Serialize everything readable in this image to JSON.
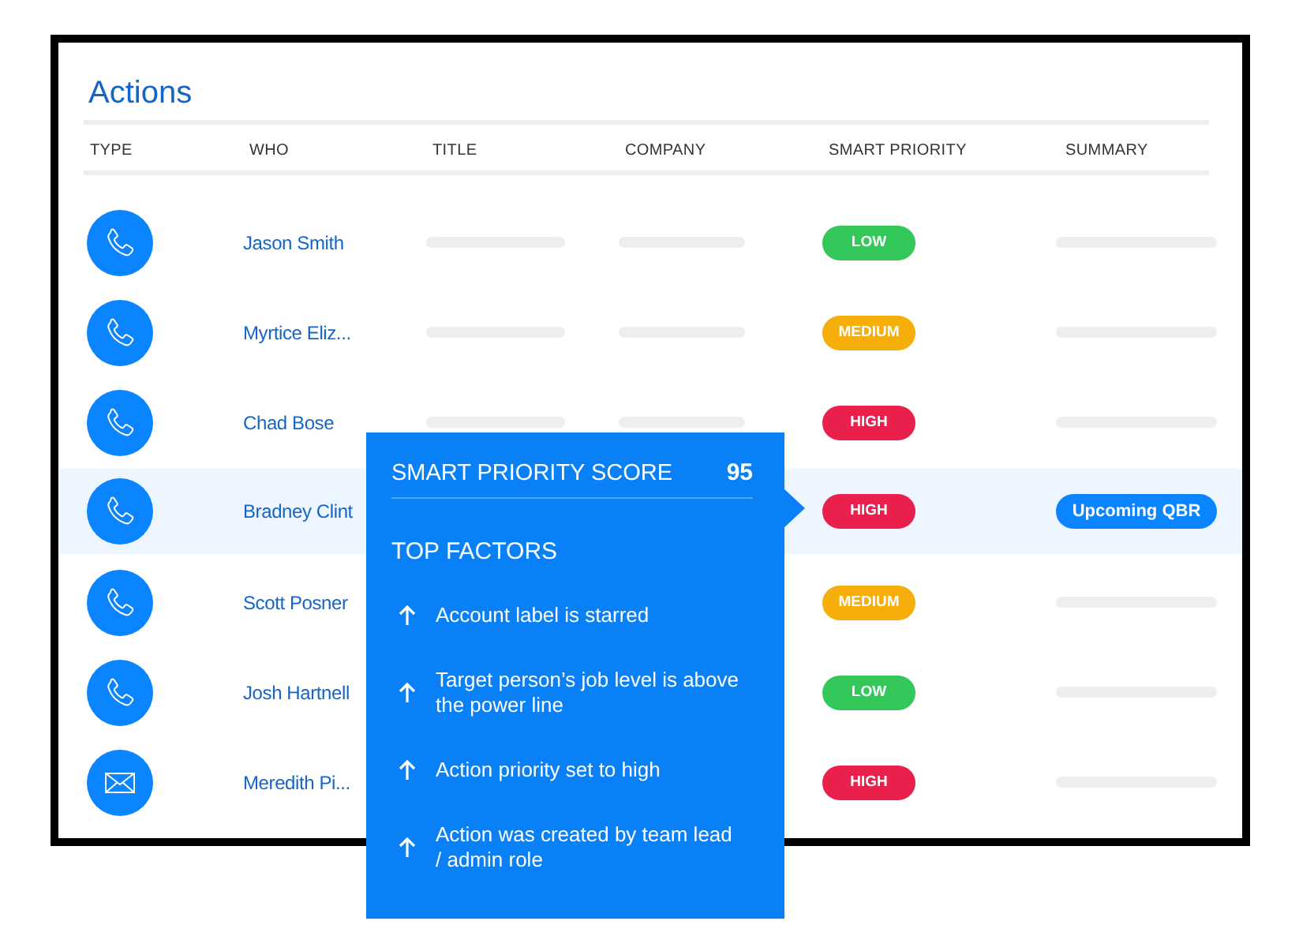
{
  "panel": {
    "title": "Actions"
  },
  "table": {
    "columns": [
      "TYPE",
      "WHO",
      "TITLE",
      "COMPANY",
      "SMART PRIORITY",
      "SUMMARY"
    ],
    "rows": [
      {
        "kind": "call",
        "who": "Jason Smith",
        "title_bar": true,
        "company_bar": true,
        "priority": {
          "label": "LOW",
          "color": "#34c759"
        },
        "summary": {
          "kind": "bar"
        },
        "selected": false
      },
      {
        "kind": "call",
        "who": "Myrtice Eliz...",
        "title_bar": true,
        "company_bar": true,
        "priority": {
          "label": "MEDIUM",
          "color": "#f6ae0a"
        },
        "summary": {
          "kind": "bar"
        },
        "selected": false
      },
      {
        "kind": "call",
        "who": "Chad Bose",
        "title_bar": true,
        "company_bar": true,
        "priority": {
          "label": "HIGH",
          "color": "#e8204b"
        },
        "summary": {
          "kind": "bar"
        },
        "selected": false
      },
      {
        "kind": "call",
        "who": "Bradney Clint",
        "title_bar": false,
        "company_bar": false,
        "priority": {
          "label": "HIGH",
          "color": "#e8204b"
        },
        "summary": {
          "kind": "tag",
          "text": "Upcoming QBR"
        },
        "selected": true
      },
      {
        "kind": "call",
        "who": "Scott Posner",
        "title_bar": false,
        "company_bar": false,
        "priority": {
          "label": "MEDIUM",
          "color": "#f6ae0a"
        },
        "summary": {
          "kind": "bar"
        },
        "selected": false
      },
      {
        "kind": "call",
        "who": "Josh Hartnell",
        "title_bar": false,
        "company_bar": false,
        "priority": {
          "label": "LOW",
          "color": "#34c759"
        },
        "summary": {
          "kind": "bar"
        },
        "selected": false
      },
      {
        "kind": "email",
        "who": "Meredith Pi...",
        "title_bar": false,
        "company_bar": false,
        "priority": {
          "label": "HIGH",
          "color": "#e8204b"
        },
        "summary": {
          "kind": "bar"
        },
        "selected": false
      }
    ]
  },
  "tooltip": {
    "title": "SMART PRIORITY SCORE",
    "score": "95",
    "subtitle": "TOP FACTORS",
    "factors": [
      "Account label is starred",
      "Target person’s job level is above the power line",
      "Action priority set to high",
      "Action was created by team lead / admin role"
    ]
  }
}
